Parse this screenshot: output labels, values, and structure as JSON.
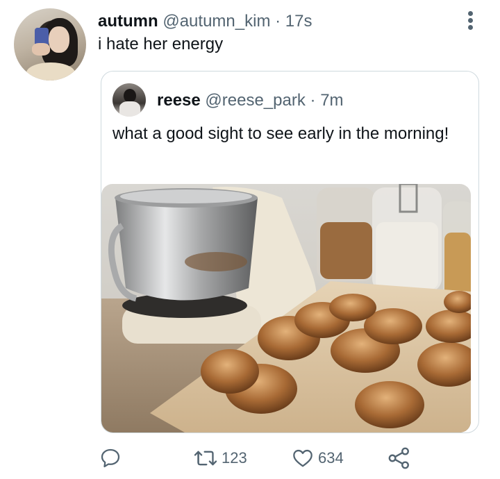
{
  "tweet": {
    "display_name": "autumn",
    "handle": "@autumn_kim",
    "separator": "·",
    "time": "17s",
    "text": "i hate her energy"
  },
  "quoted_tweet": {
    "display_name": "reese",
    "handle": "@reese_park",
    "separator": "·",
    "time": "7m",
    "text": "what a good sight to see early in the morning!"
  },
  "actions": {
    "reply_count": "",
    "retweet_count": "123",
    "like_count": "634"
  },
  "icons": {
    "more": "more-vertical-icon",
    "reply": "reply-icon",
    "retweet": "retweet-icon",
    "like": "heart-icon",
    "share": "share-icon"
  },
  "colors": {
    "text_primary": "#0f1419",
    "text_muted": "#536471",
    "border": "#cfd9de"
  }
}
